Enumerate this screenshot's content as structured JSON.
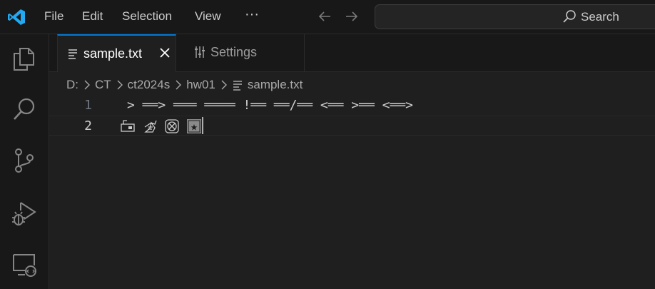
{
  "menu": {
    "file": "File",
    "edit": "Edit",
    "selection": "Selection",
    "view": "View",
    "more": "···"
  },
  "search": {
    "label": "Search"
  },
  "tabs": [
    {
      "label": "sample.txt",
      "active": true
    },
    {
      "label": "Settings",
      "active": false
    }
  ],
  "breadcrumb": [
    "D:",
    "CT",
    "ct2024s",
    "hw01",
    "sample.txt"
  ],
  "editor": {
    "lines": [
      {
        "number": "1",
        "text": "> ══> ═══ ════ !══ ══/══ <══ >══ <══>"
      },
      {
        "number": "2",
        "text": ""
      }
    ]
  },
  "colors": {
    "accent": "#0078d4",
    "logo": "#23a9f2"
  }
}
